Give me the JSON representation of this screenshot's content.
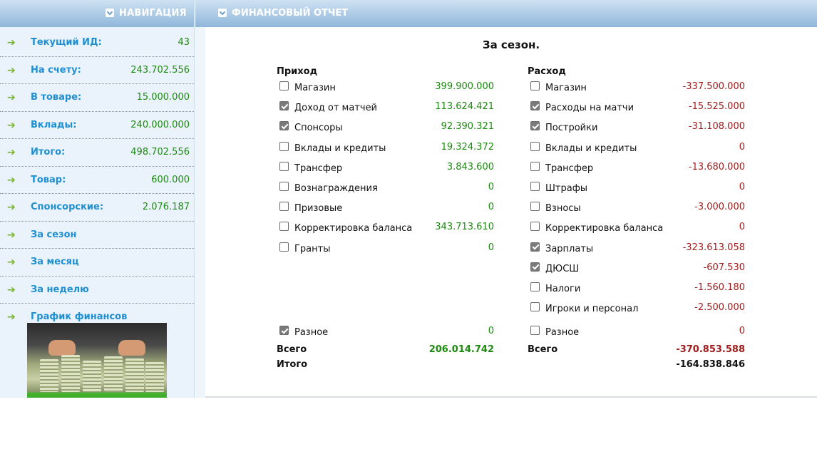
{
  "sidebar": {
    "title": "НАВИГАЦИЯ",
    "items": [
      {
        "label": "Текущий ИД:",
        "value": "43"
      },
      {
        "label": "На счету:",
        "value": "243.702.556"
      },
      {
        "label": "В товаре:",
        "value": "15.000.000"
      },
      {
        "label": "Вклады:",
        "value": "240.000.000"
      },
      {
        "label": "Итого:",
        "value": "498.702.556"
      },
      {
        "label": "Товар:",
        "value": "600.000"
      },
      {
        "label": "Спонсорские:",
        "value": "2.076.187"
      },
      {
        "label": "За сезон",
        "value": ""
      },
      {
        "label": "За месяц",
        "value": ""
      },
      {
        "label": "За неделю",
        "value": ""
      },
      {
        "label": "График финансов",
        "value": ""
      }
    ]
  },
  "main": {
    "title": "ФИНАНСОВЫЙ ОТЧЕТ",
    "report_title": "За сезон.",
    "income": {
      "heading": "Приход",
      "rows": [
        {
          "label": "Магазин",
          "value": "399.900.000",
          "checked": false
        },
        {
          "label": "Доход от матчей",
          "value": "113.624.421",
          "checked": true
        },
        {
          "label": "Спонсоры",
          "value": "92.390.321",
          "checked": true
        },
        {
          "label": "Вклады и кредиты",
          "value": "19.324.372",
          "checked": false
        },
        {
          "label": "Трансфер",
          "value": "3.843.600",
          "checked": false
        },
        {
          "label": "Вознаграждения",
          "value": "0",
          "checked": false
        },
        {
          "label": "Призовые",
          "value": "0",
          "checked": false
        },
        {
          "label": "Корректировка баланса",
          "value": "343.713.610",
          "checked": false
        },
        {
          "label": "Гранты",
          "value": "0",
          "checked": false
        }
      ],
      "misc": {
        "label": "Разное",
        "value": "0",
        "checked": true
      },
      "total_label": "Всего",
      "total_value": "206.014.742",
      "grand_label": "Итого"
    },
    "expense": {
      "heading": "Расход",
      "rows": [
        {
          "label": "Магазин",
          "value": "-337.500.000",
          "checked": false
        },
        {
          "label": "Расходы на матчи",
          "value": "-15.525.000",
          "checked": true
        },
        {
          "label": "Постройки",
          "value": "-31.108.000",
          "checked": true
        },
        {
          "label": "Вклады и кредиты",
          "value": "0",
          "checked": false
        },
        {
          "label": "Трансфер",
          "value": "-13.680.000",
          "checked": false
        },
        {
          "label": "Штрафы",
          "value": "0",
          "checked": false
        },
        {
          "label": "Взносы",
          "value": "-3.000.000",
          "checked": false
        },
        {
          "label": "Корректировка баланса",
          "value": "0",
          "checked": false
        },
        {
          "label": "Зарплаты",
          "value": "-323.613.058",
          "checked": true
        },
        {
          "label": "ДЮСШ",
          "value": "-607.530",
          "checked": true
        },
        {
          "label": "Налоги",
          "value": "-1.560.180",
          "checked": false
        },
        {
          "label": "Игроки и персонал",
          "value": "-2.500.000",
          "checked": false
        }
      ],
      "misc": {
        "label": "Разное",
        "value": "0",
        "checked": false
      },
      "total_label": "Всего",
      "total_value": "-370.853.588",
      "grand_value": "-164.838.846"
    }
  },
  "colors": {
    "header_gradient_top": "#cfe2f3",
    "header_gradient_bottom": "#8fb6da",
    "nav_label": "#1f8fd1",
    "positive": "#1c8a0f",
    "negative": "#a01c1c",
    "arrow": "#78b22a"
  }
}
